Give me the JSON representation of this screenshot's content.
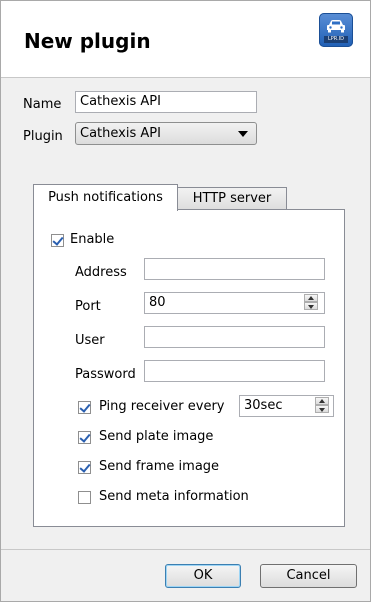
{
  "dialog": {
    "title": "New plugin",
    "logo_text": "LPR.ID"
  },
  "form": {
    "name_label": "Name",
    "name_value": "Cathexis API",
    "plugin_label": "Plugin",
    "plugin_value": "Cathexis API"
  },
  "tabs": [
    {
      "label": "Push notifications",
      "active": true
    },
    {
      "label": "HTTP server",
      "active": false
    }
  ],
  "push": {
    "enable_label": "Enable",
    "enable_checked": true,
    "address_label": "Address",
    "address_value": "",
    "port_label": "Port",
    "port_value": "80",
    "user_label": "User",
    "user_value": "",
    "password_label": "Password",
    "password_value": "",
    "ping_label": "Ping receiver every",
    "ping_checked": true,
    "ping_value": "30sec",
    "plate_label": "Send plate image",
    "plate_checked": true,
    "frame_label": "Send frame image",
    "frame_checked": true,
    "meta_label": "Send meta information",
    "meta_checked": false
  },
  "buttons": {
    "ok": "OK",
    "cancel": "Cancel"
  },
  "colors": {
    "logo_blue": "#2f6fc4",
    "check_blue": "#2a5fb0",
    "default_button_border": "#3c7fb1"
  }
}
